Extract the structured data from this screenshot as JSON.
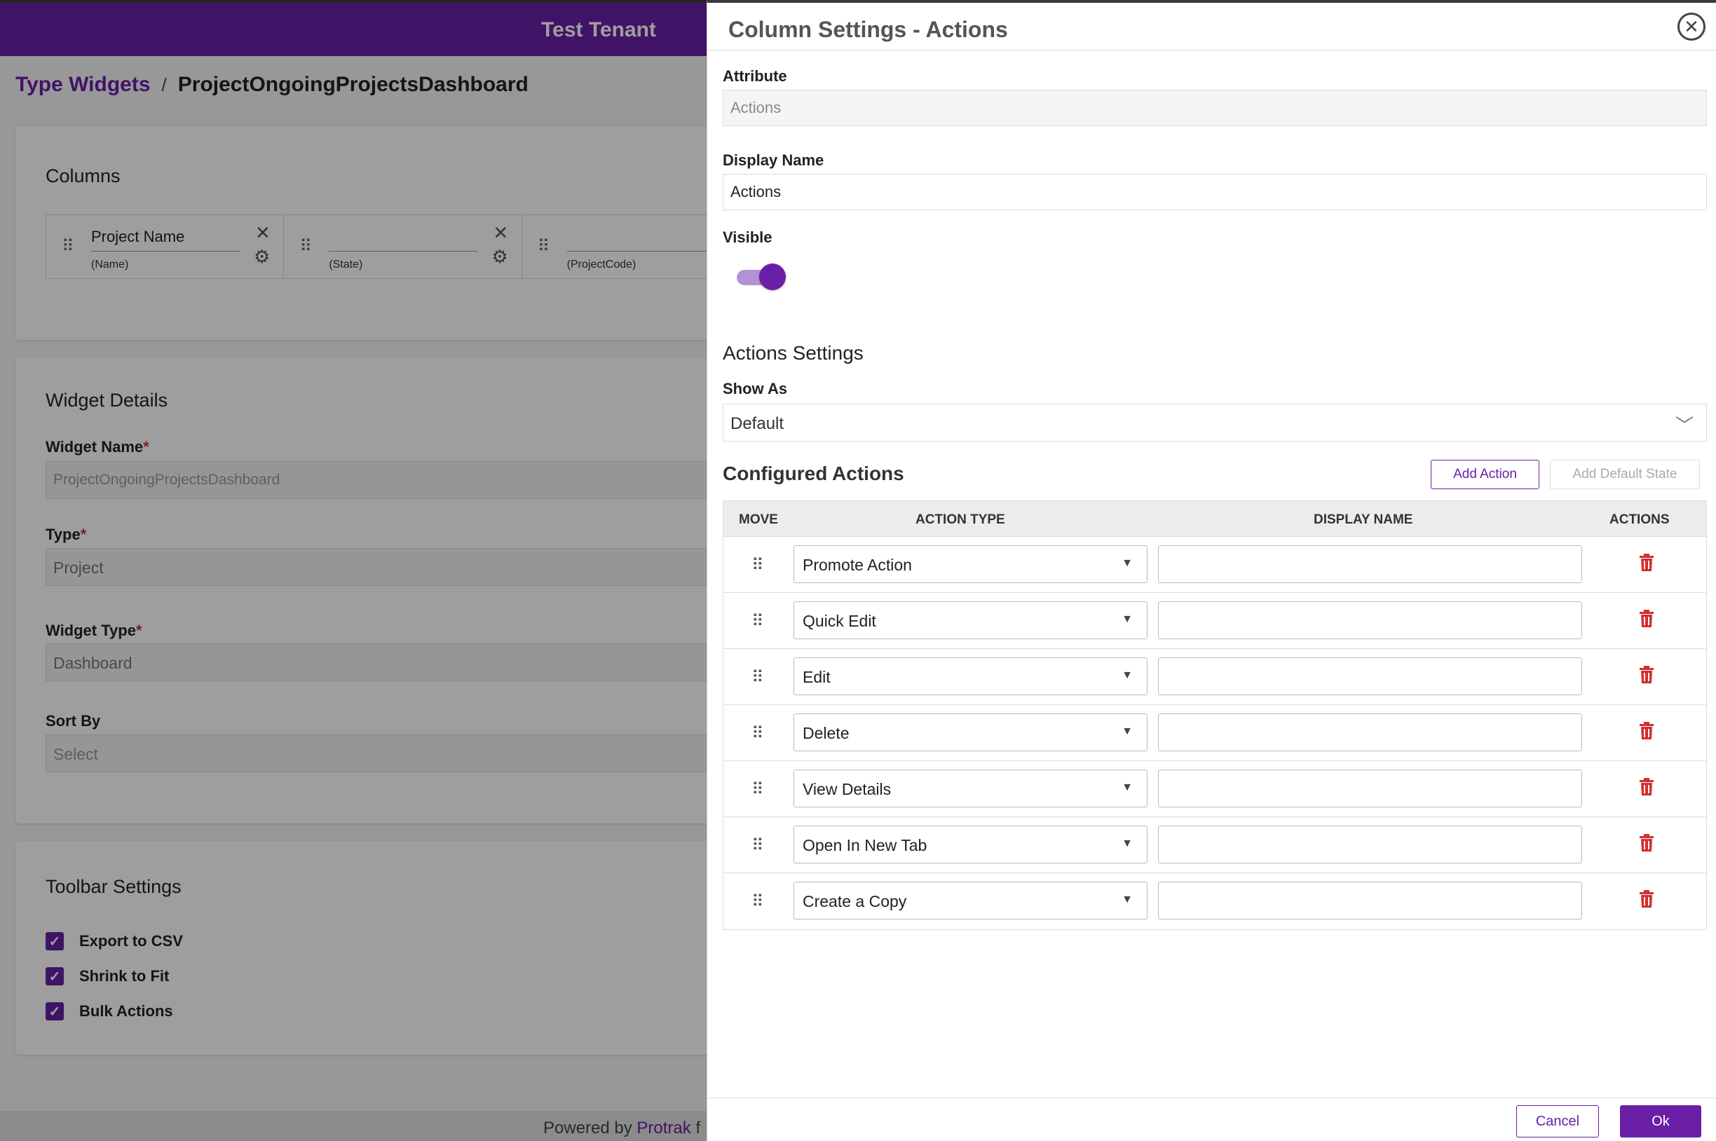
{
  "header": {
    "tenant": "Test Tenant"
  },
  "breadcrumb": {
    "parent": "Type Widgets",
    "separator": "/",
    "current": "ProjectOngoingProjectsDashboard"
  },
  "columns_card": {
    "title": "Columns",
    "columns": [
      {
        "name": "Project Name",
        "attr": "(Name)"
      },
      {
        "name": "",
        "attr": "(State)"
      },
      {
        "name": "",
        "attr": "(ProjectCode)"
      }
    ]
  },
  "widget_details": {
    "title": "Widget Details",
    "required_mark": "*",
    "fields": [
      {
        "label": "Widget Name",
        "required": true,
        "value": "ProjectOngoingProjectsDashboard"
      },
      {
        "label": "Type",
        "required": true,
        "value": "Project"
      },
      {
        "label": "Widget Type",
        "required": true,
        "value": "Dashboard"
      },
      {
        "label": "Sort By",
        "required": false,
        "value": "Select"
      }
    ]
  },
  "toolbar_settings": {
    "title": "Toolbar Settings",
    "options": [
      "Export to CSV",
      "Shrink to Fit",
      "Bulk Actions"
    ]
  },
  "footer": {
    "powered_prefix": "Powered by",
    "brand": "Protrak",
    "suffix": "f"
  },
  "modal": {
    "title": "Column Settings - Actions",
    "attribute_label": "Attribute",
    "attribute_value": "Actions",
    "display_name_label": "Display Name",
    "display_name_value": "Actions",
    "visible_label": "Visible",
    "visible": true,
    "actions_settings_title": "Actions Settings",
    "show_as_label": "Show As",
    "show_as_value": "Default",
    "configured_actions_title": "Configured Actions",
    "add_action": "Add Action",
    "add_default_state": "Add Default State",
    "table": {
      "headers": {
        "move": "MOVE",
        "action_type": "ACTION TYPE",
        "display_name": "DISPLAY NAME",
        "actions": "ACTIONS"
      },
      "rows": [
        {
          "action_type": "Promote Action",
          "display_name": ""
        },
        {
          "action_type": "Quick Edit",
          "display_name": ""
        },
        {
          "action_type": "Edit",
          "display_name": ""
        },
        {
          "action_type": "Delete",
          "display_name": ""
        },
        {
          "action_type": "View Details",
          "display_name": ""
        },
        {
          "action_type": "Open In New Tab",
          "display_name": ""
        },
        {
          "action_type": "Create a Copy",
          "display_name": ""
        }
      ]
    },
    "cancel": "Cancel",
    "ok": "Ok"
  },
  "colors": {
    "brand": "#6a1fa6",
    "danger": "#d32f2f"
  }
}
